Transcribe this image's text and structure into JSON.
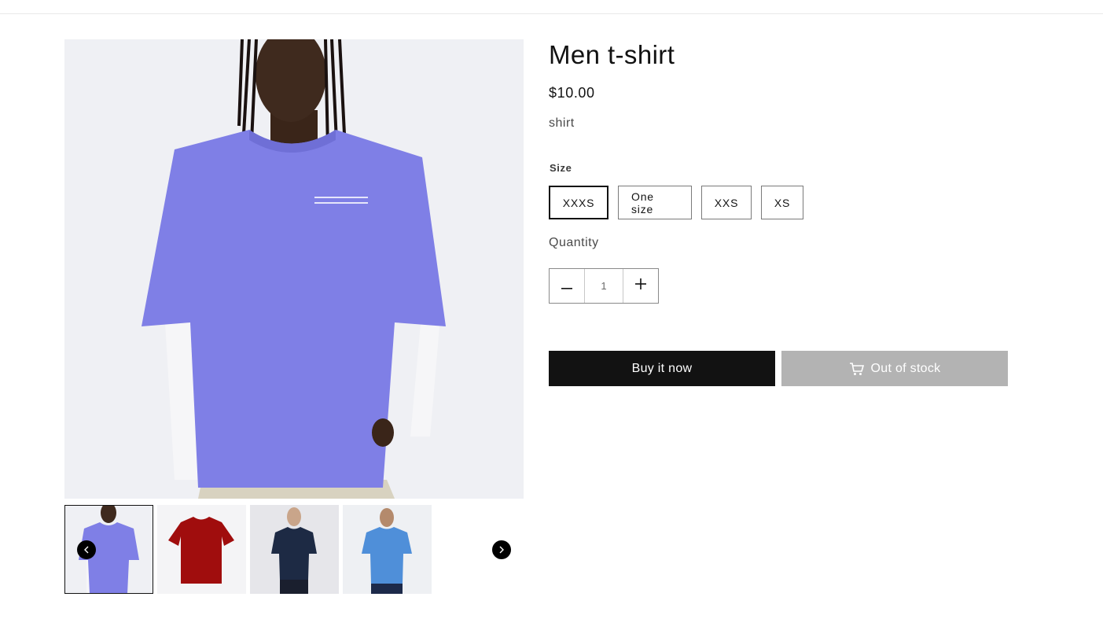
{
  "product": {
    "title": "Men t-shirt",
    "price": "$10.00",
    "description": "shirt"
  },
  "media": {
    "main_alt": "Model wearing oversized purple t-shirt over white long-sleeve",
    "print_text": "",
    "thumbnails": [
      {
        "label": "Purple oversized t-shirt",
        "active": true
      },
      {
        "label": "Red t-shirt",
        "active": false
      },
      {
        "label": "Navy t-shirt on model",
        "active": false
      },
      {
        "label": "Light blue t-shirt on model",
        "active": false
      }
    ],
    "prev_icon": "chevron-left-icon",
    "next_icon": "chevron-right-icon"
  },
  "variant": {
    "size_label": "Size",
    "sizes": [
      "XXXS",
      "One size",
      "XXS",
      "XS"
    ],
    "selected": "XXXS"
  },
  "quantity": {
    "label": "Quantity",
    "value": "1",
    "minus_icon": "minus-icon",
    "plus_icon": "plus-icon"
  },
  "actions": {
    "buy_now": "Buy it now",
    "out_of_stock": "Out of stock",
    "cart_icon": "cart-icon"
  },
  "colors": {
    "primary": "#121212",
    "disabled": "#b3b3b3",
    "shirt_purple": "#7f7fe6"
  }
}
